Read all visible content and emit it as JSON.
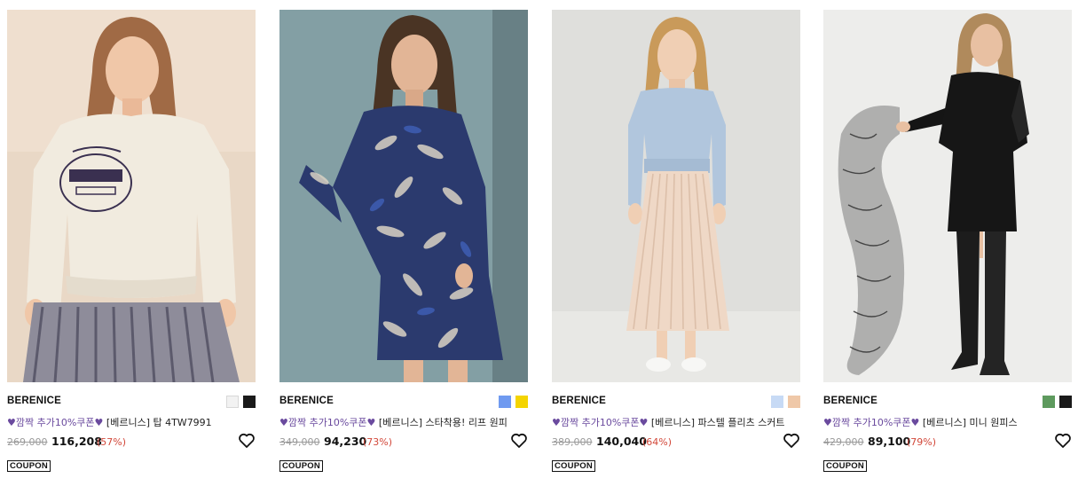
{
  "products": [
    {
      "brand": "BERENICE",
      "swatches": [
        "#f2f2f2",
        "#1a1a1a"
      ],
      "heart_glyph": "♥",
      "promo": "깜짝 추가10%쿠폰",
      "promo_tail": "♥",
      "name": " [베르니스] 탑 4TW7991",
      "original_price": "269,000",
      "sale_price": "116,208",
      "discount": "(57%)",
      "coupon": "COUPON",
      "wishlist_icon": "heart-outline-icon"
    },
    {
      "brand": "BERENICE",
      "swatches": [
        "#6f9af0",
        "#f4d400"
      ],
      "heart_glyph": "♥",
      "promo": "깜짝 추가10%쿠폰",
      "promo_tail": "♥",
      "name": " [베르니스] 스타착용! 리프 원피",
      "original_price": "349,000",
      "sale_price": "94,230",
      "discount": "(73%)",
      "coupon": "COUPON",
      "wishlist_icon": "heart-outline-icon"
    },
    {
      "brand": "BERENICE",
      "swatches": [
        "#c7daf5",
        "#efc8a8"
      ],
      "heart_glyph": "♥",
      "promo": "깜짝 추가10%쿠폰",
      "promo_tail": "♥",
      "name": " [베르니스] 파스텔 플리츠 스커트",
      "original_price": "389,000",
      "sale_price": "140,040",
      "discount": "(64%)",
      "coupon": "COUPON",
      "wishlist_icon": "heart-outline-icon"
    },
    {
      "brand": "BERENICE",
      "swatches": [
        "#5e9a5e",
        "#1a1a1a"
      ],
      "heart_glyph": "♥",
      "promo": "깜짝 추가10%쿠폰",
      "promo_tail": "♥",
      "name": " [베르니스] 미니 원피스",
      "original_price": "429,000",
      "sale_price": "89,100",
      "discount": "(79%)",
      "coupon": "COUPON",
      "wishlist_icon": "heart-outline-icon"
    }
  ]
}
